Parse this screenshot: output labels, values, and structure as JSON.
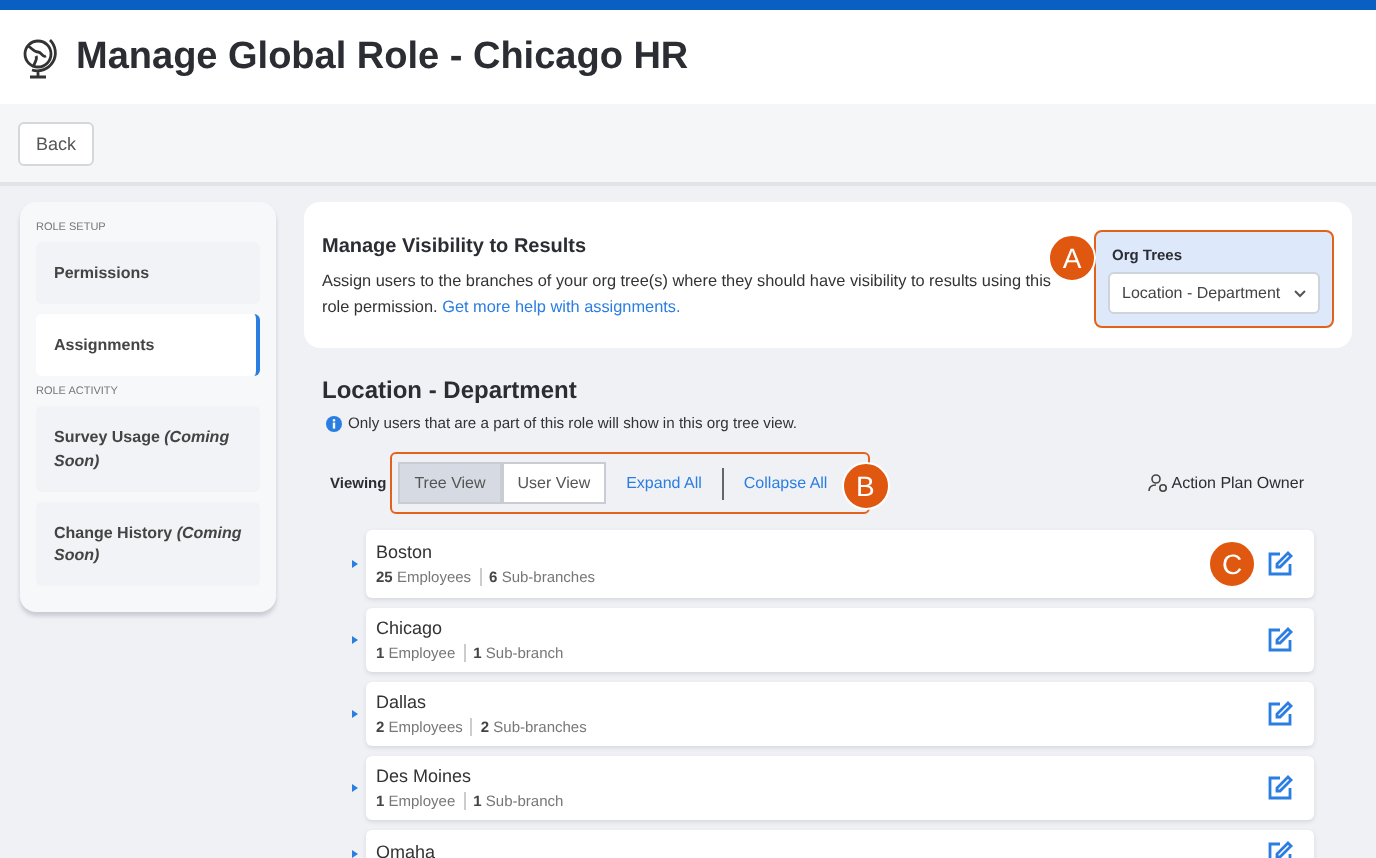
{
  "header": {
    "title": "Manage Global Role - Chicago HR"
  },
  "toolbar": {
    "back_button": "Back"
  },
  "sidebar": {
    "sections": [
      {
        "heading": "ROLE SETUP",
        "items": [
          {
            "label": "Permissions",
            "selected": false
          },
          {
            "label": "Assignments",
            "selected": true
          }
        ]
      },
      {
        "heading": "ROLE ACTIVITY",
        "items": [
          {
            "label": "Survey Usage *(Coming Soon)*",
            "selected": false
          },
          {
            "label": "Change History *(Coming Soon)*",
            "selected": false
          }
        ]
      }
    ]
  },
  "visibility_card": {
    "title": "Manage Visibility to Results",
    "description": "Assign users to the branches of your org tree(s) where they should have visibility to results using this role permission.",
    "help_link": "Get more help with assignments.",
    "org_trees": {
      "label": "Org Trees",
      "value": "Location - Department",
      "callout": "A"
    }
  },
  "tree_section": {
    "title": "Location - Department",
    "info": "Only users that are a part of this role will show in this org tree view.",
    "viewing_label": "Viewing",
    "views": [
      {
        "label": "Tree View",
        "selected": true
      },
      {
        "label": "User View",
        "selected": false
      }
    ],
    "expand_all": "Expand All",
    "collapse_all": "Collapse All",
    "controls_callout": "B",
    "legend": "Action Plan Owner",
    "branches": [
      {
        "name": "Boston",
        "employees": "25",
        "employees_label": "Employees",
        "subbranches": "6",
        "subbranches_label": "Sub-branches",
        "callout": "C"
      },
      {
        "name": "Chicago",
        "employees": "1",
        "employees_label": "Employee",
        "subbranches": "1",
        "subbranches_label": "Sub-branch"
      },
      {
        "name": "Dallas",
        "employees": "2",
        "employees_label": "Employees",
        "subbranches": "2",
        "subbranches_label": "Sub-branches"
      },
      {
        "name": "Des Moines",
        "employees": "1",
        "employees_label": "Employee",
        "subbranches": "1",
        "subbranches_label": "Sub-branch"
      },
      {
        "name": "Omaha"
      }
    ]
  }
}
